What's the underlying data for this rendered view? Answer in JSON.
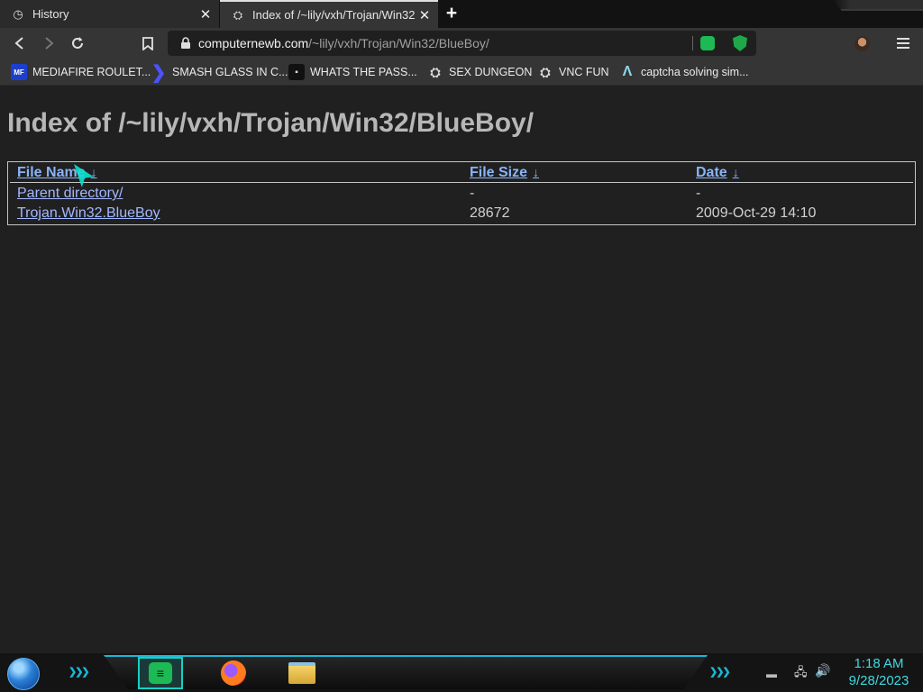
{
  "tabs": [
    {
      "title": "History",
      "icon": "history-icon"
    },
    {
      "title": "Index of /~lily/vxh/Trojan/Win32/B",
      "icon": "robot-icon"
    }
  ],
  "new_tab_glyph": "+",
  "address": {
    "host": "computernewb.com",
    "path": "/~lily/vxh/Trojan/Win32/BlueBoy/"
  },
  "bookmarks": [
    {
      "label": "MEDIAFIRE ROULET...",
      "icon_text": "MF"
    },
    {
      "label": "SMASH GLASS IN C...",
      "icon_text": ""
    },
    {
      "label": "WHATS THE PASS...",
      "icon_text": ""
    },
    {
      "label": "SEX DUNGEON",
      "icon_text": ""
    },
    {
      "label": "VNC FUN",
      "icon_text": ""
    },
    {
      "label": "captcha solving sim...",
      "icon_text": ""
    }
  ],
  "page": {
    "title": "Index of /~lily/vxh/Trojan/Win32/BlueBoy/",
    "columns": [
      {
        "label": "File Name",
        "sort": "↓"
      },
      {
        "label": "File Size",
        "sort": "↓"
      },
      {
        "label": "Date",
        "sort": "↓"
      }
    ],
    "rows": [
      {
        "name": "Parent directory/",
        "size": "-",
        "date": "-"
      },
      {
        "name": "Trojan.Win32.BlueBoy",
        "size": "28672",
        "date": "2009-Oct-29 14:10"
      }
    ]
  },
  "taskbar": {
    "time": "1:18 AM",
    "date": "9/28/2023"
  },
  "colors": {
    "link": "#a2b8ff",
    "header_link": "#8ab4f8",
    "accent": "#18b8d8",
    "clock": "#3fd9e0"
  }
}
